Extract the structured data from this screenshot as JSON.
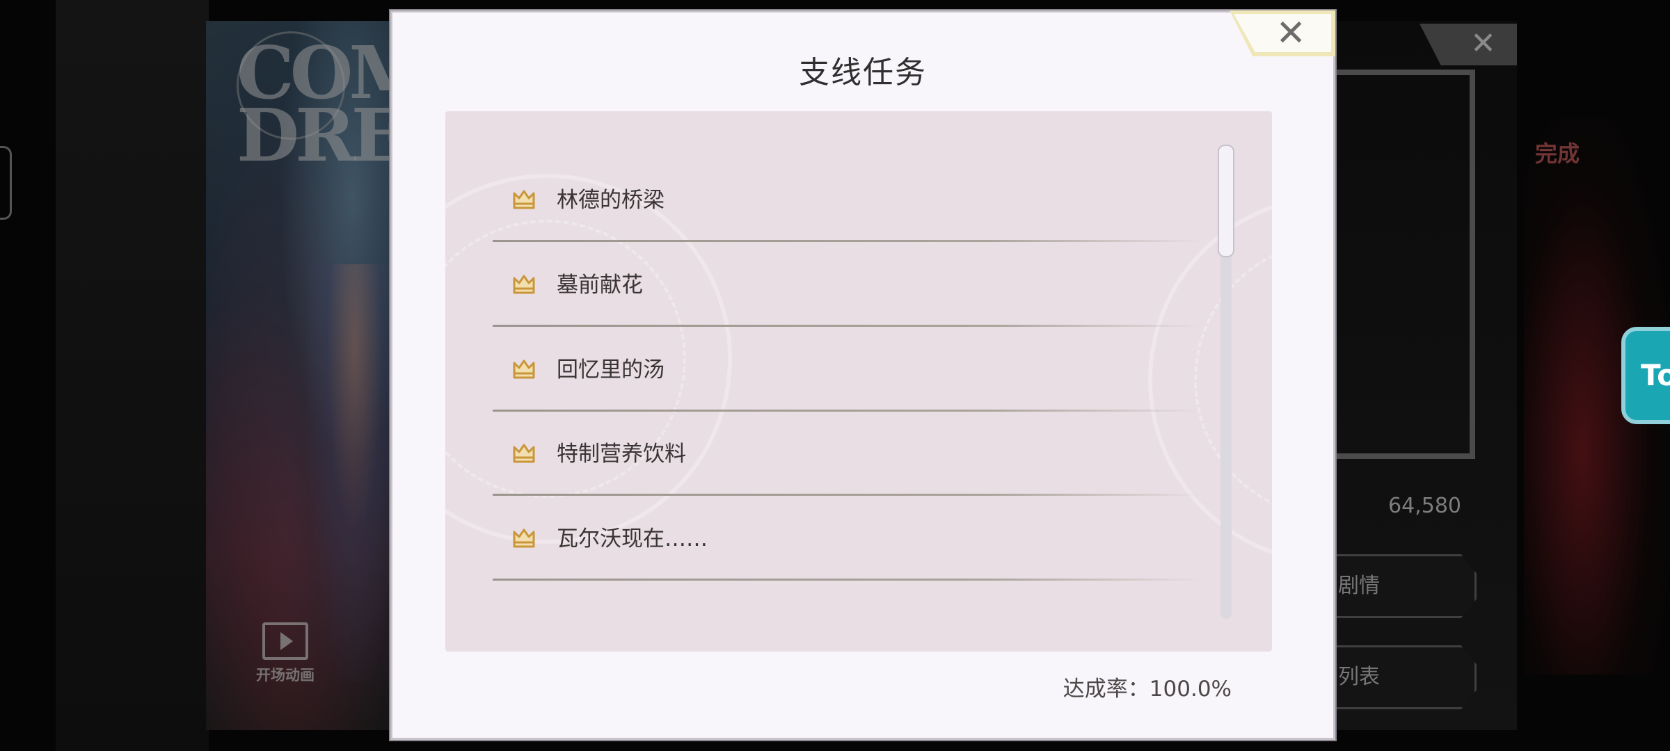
{
  "dialog": {
    "title": "支线任务",
    "close_label": "✕",
    "items": [
      {
        "label": "林德的桥梁",
        "icon": "crown-icon"
      },
      {
        "label": "墓前献花",
        "icon": "crown-icon"
      },
      {
        "label": "回忆里的汤",
        "icon": "crown-icon"
      },
      {
        "label": "特制营养饮料",
        "icon": "crown-icon"
      },
      {
        "label": "瓦尔沃现在……",
        "icon": "crown-icon"
      }
    ],
    "completion_text": "达成率：100.0%"
  },
  "background": {
    "video_label": "开场动画",
    "complete_label": "完成",
    "score": "64,580",
    "button_1": "剧情",
    "button_2": "列表",
    "close_label": "✕",
    "side_button": "To"
  },
  "colors": {
    "dialog_bg": "#f8f6fb",
    "list_bg": "#e9dee3",
    "crown_gold": "#c9963a",
    "close_accent": "#efe7b8"
  }
}
